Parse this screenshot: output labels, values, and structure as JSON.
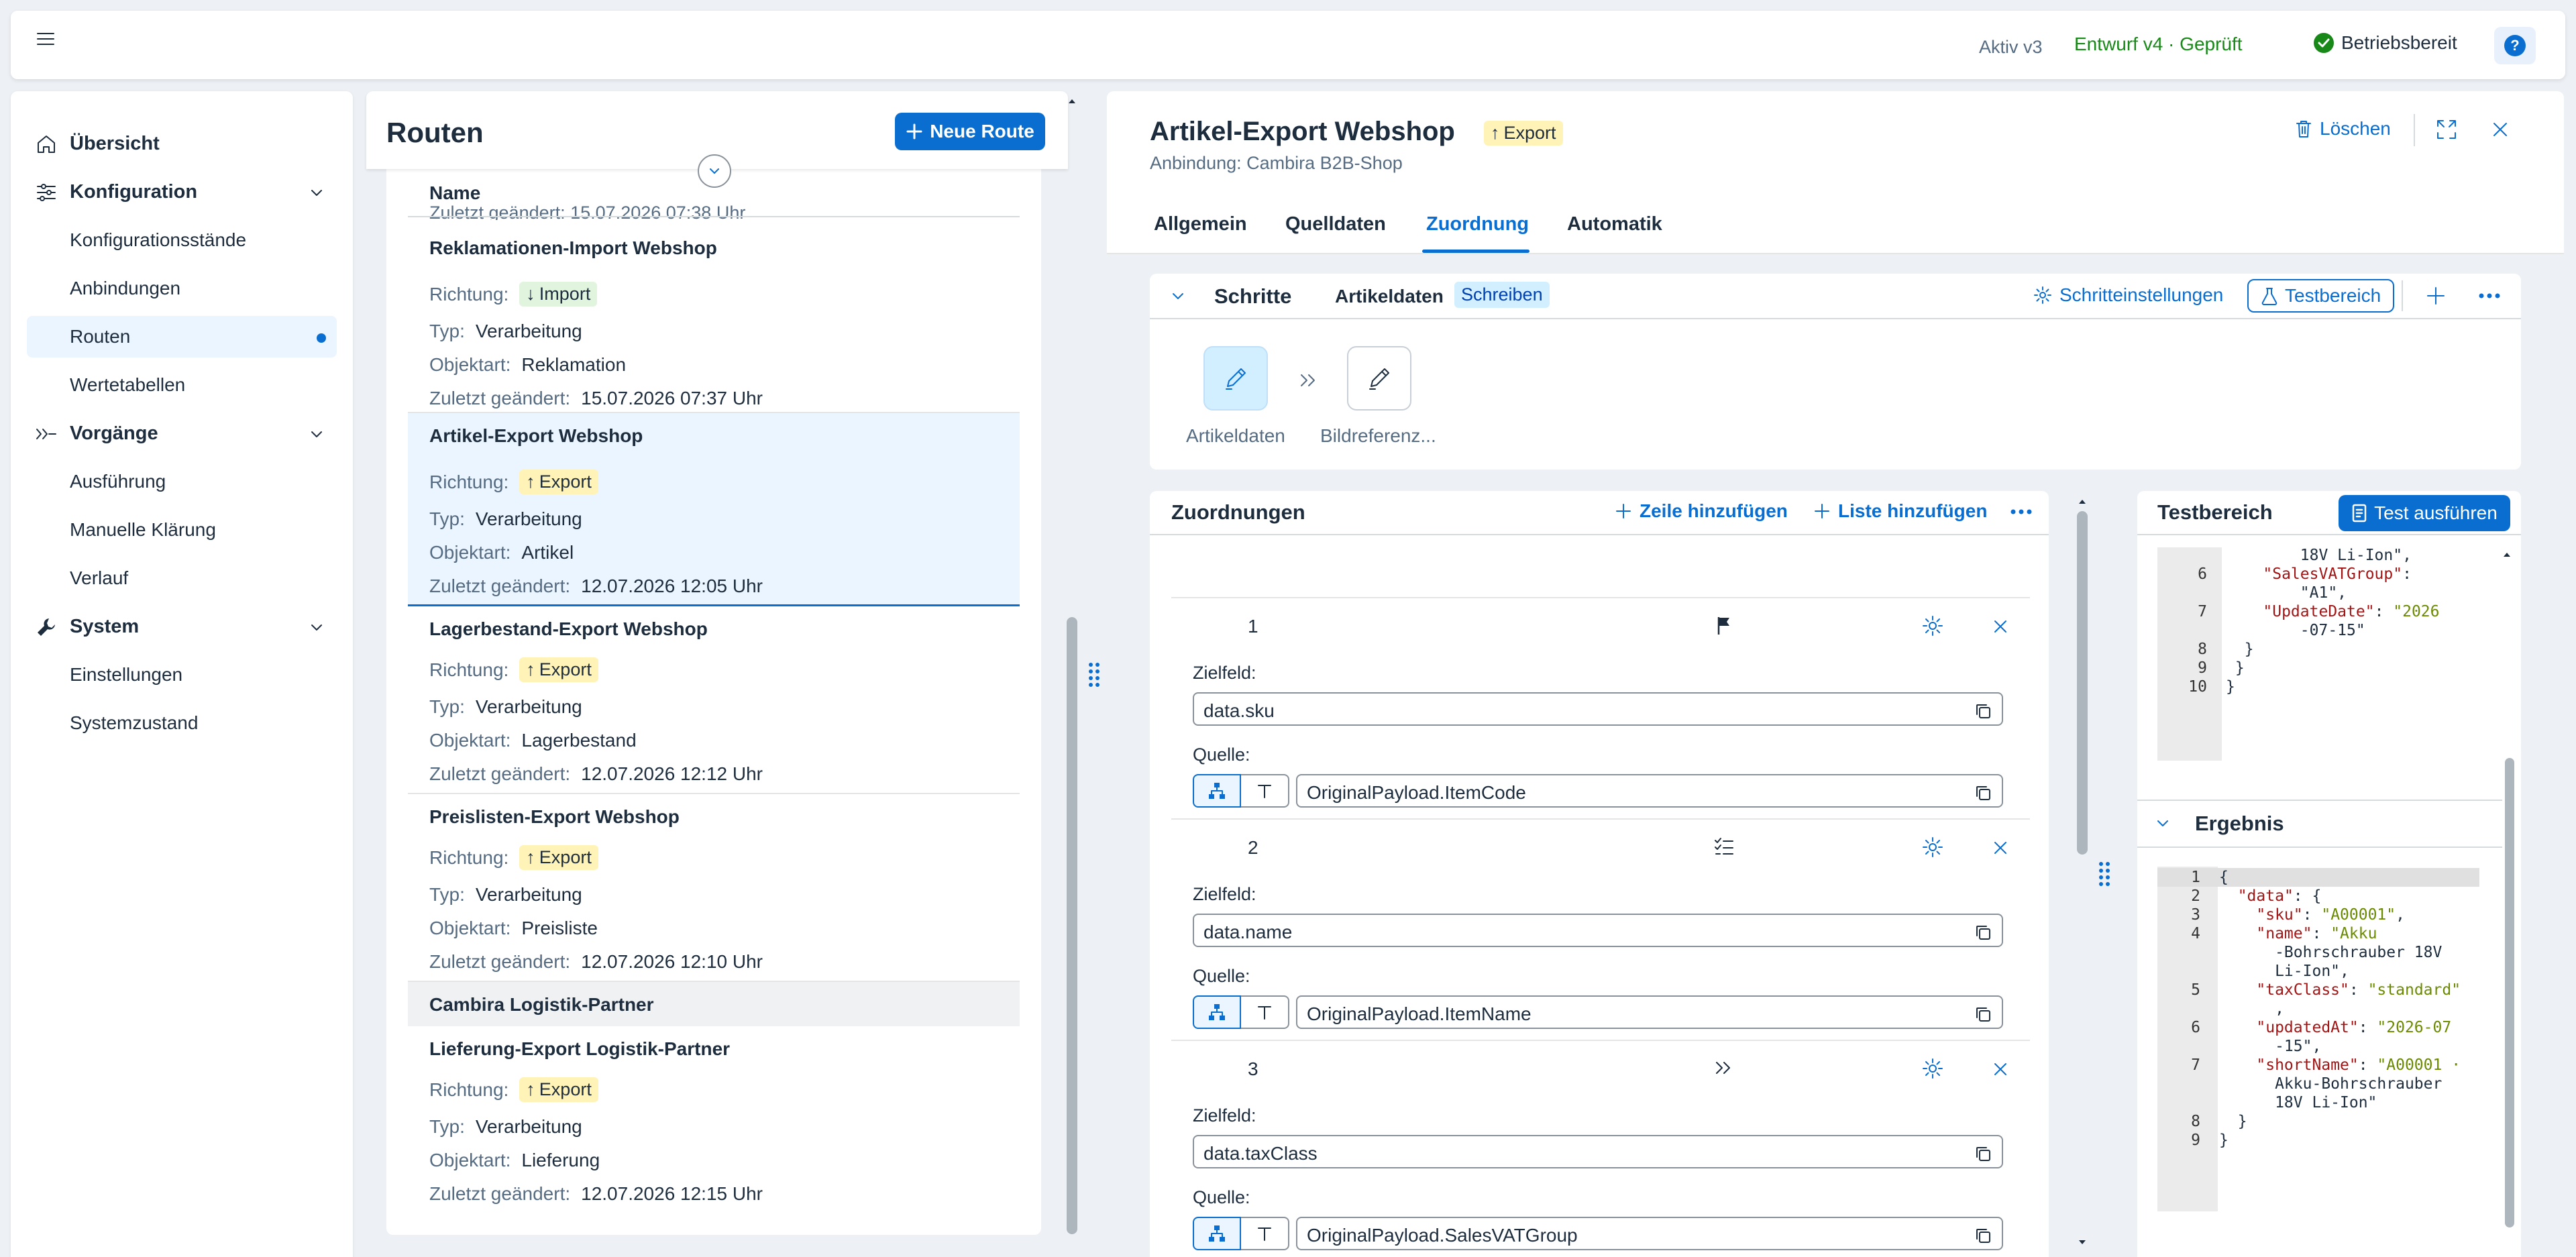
{
  "shell": {
    "version_active": "Aktiv v3",
    "version_draft": "Entwurf v4 · Geprüft",
    "status": "Betriebsbereit",
    "colors": {
      "accent": "#0a6ed1",
      "positive": "#188918"
    }
  },
  "sidenav": {
    "items": [
      {
        "label": "Übersicht",
        "icon": "home-icon"
      },
      {
        "label": "Konfiguration",
        "icon": "sliders-icon"
      },
      {
        "label": "Konfigurationsstände"
      },
      {
        "label": "Anbindungen"
      },
      {
        "label": "Routen"
      },
      {
        "label": "Wertetabellen"
      },
      {
        "label": "Vorgänge",
        "icon": "process-icon"
      },
      {
        "label": "Ausführung"
      },
      {
        "label": "Manuelle Klärung"
      },
      {
        "label": "Verlauf"
      },
      {
        "label": "System",
        "icon": "wrench-icon"
      },
      {
        "label": "Einstellungen"
      },
      {
        "label": "Systemzustand"
      }
    ]
  },
  "routes": {
    "title": "Routen",
    "new_button": "Neue Route",
    "column_name": "Name",
    "clipped_text": "Zuletzt geändert:  15.07.2026 07:38 Uhr",
    "labels": {
      "direction": "Richtung:",
      "type": "Typ:",
      "object": "Objektart:",
      "changed": "Zuletzt geändert:"
    },
    "items": [
      {
        "title": "Reklamationen-Import Webshop",
        "direction": "Import",
        "type": "Verarbeitung",
        "object": "Reklamation",
        "changed": "15.07.2026 07:37 Uhr"
      },
      {
        "title": "Artikel-Export Webshop",
        "direction": "Export",
        "type": "Verarbeitung",
        "object": "Artikel",
        "changed": "12.07.2026 12:05 Uhr"
      },
      {
        "title": "Lagerbestand-Export Webshop",
        "direction": "Export",
        "type": "Verarbeitung",
        "object": "Lagerbestand",
        "changed": "12.07.2026 12:12 Uhr"
      },
      {
        "title": "Preislisten-Export Webshop",
        "direction": "Export",
        "type": "Verarbeitung",
        "object": "Preisliste",
        "changed": "12.07.2026 12:10 Uhr"
      },
      {
        "title": "Lieferung-Export Logistik-Partner",
        "direction": "Export",
        "type": "Verarbeitung",
        "object": "Lieferung",
        "changed": "12.07.2026 12:15 Uhr"
      }
    ],
    "group": "Cambira Logistik-Partner"
  },
  "detail": {
    "title": "Artikel-Export Webshop",
    "badge": "Export",
    "subtitle": "Anbindung: Cambira B2B-Shop",
    "delete": "Löschen",
    "tabs": [
      "Allgemein",
      "Quelldaten",
      "Zuordnung",
      "Automatik"
    ],
    "steps": {
      "title": "Schritte",
      "object": "Artikeldaten",
      "mode": "Schreiben",
      "settings": "Schritteinstellungen",
      "test": "Testbereich",
      "step1": "Artikeldaten",
      "step2": "Bildreferenz..."
    },
    "mappings": {
      "title": "Zuordnungen",
      "add_row": "Zeile hinzufügen",
      "add_list": "Liste hinzufügen",
      "target_label": "Zielfeld:",
      "source_label": "Quelle:",
      "rows": [
        {
          "num": "1",
          "target": "data.sku",
          "source": "OriginalPayload.ItemCode",
          "type_icon": "flag-icon"
        },
        {
          "num": "2",
          "target": "data.name",
          "source": "OriginalPayload.ItemName",
          "type_icon": "checklist-icon"
        },
        {
          "num": "3",
          "target": "data.taxClass",
          "source": "OriginalPayload.SalesVATGroup",
          "type_icon": "double-chevron-icon"
        }
      ]
    },
    "test": {
      "title": "Testbereich",
      "run": "Test ausführen",
      "result_title": "Ergebnis",
      "input_lines": [
        {
          "n": "",
          "t": "        18V Li-Ion\","
        },
        {
          "n": "6",
          "t": "    \"SalesVATGroup\":"
        },
        {
          "n": "",
          "t": "        \"A1\","
        },
        {
          "n": "7",
          "t": "    \"UpdateDate\": \"2026"
        },
        {
          "n": "",
          "t": "        -07-15\""
        },
        {
          "n": "8",
          "t": "  }"
        },
        {
          "n": "9",
          "t": " }"
        },
        {
          "n": "10",
          "t": "}"
        }
      ],
      "result_lines": [
        {
          "n": "1",
          "t": "{"
        },
        {
          "n": "2",
          "t": "  \"data\": {"
        },
        {
          "n": "3",
          "t": "    \"sku\": \"A00001\","
        },
        {
          "n": "4",
          "t": "    \"name\": \"Akku"
        },
        {
          "n": "",
          "t": "      -Bohrschrauber 18V"
        },
        {
          "n": "",
          "t": "      Li-Ion\","
        },
        {
          "n": "5",
          "t": "    \"taxClass\": \"standard\""
        },
        {
          "n": "",
          "t": "      ,"
        },
        {
          "n": "6",
          "t": "    \"updatedAt\": \"2026-07"
        },
        {
          "n": "",
          "t": "      -15\","
        },
        {
          "n": "7",
          "t": "    \"shortName\": \"A00001 ·"
        },
        {
          "n": "",
          "t": "      Akku-Bohrschrauber"
        },
        {
          "n": "",
          "t": "      18V Li-Ion\""
        },
        {
          "n": "8",
          "t": "  }"
        },
        {
          "n": "9",
          "t": "}"
        }
      ]
    }
  }
}
